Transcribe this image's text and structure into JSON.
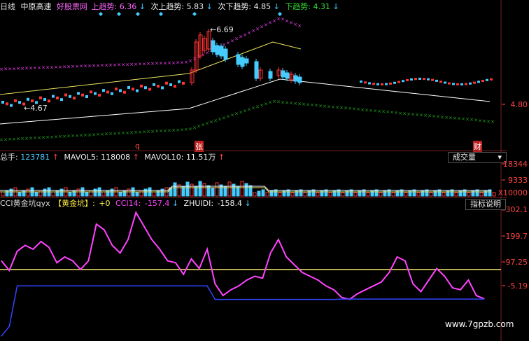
{
  "price_panel": {
    "period": "日线",
    "stock_name": "中原高速",
    "indicator_name": "好股票网",
    "up_trend_label": "上趋势:",
    "up_trend_value": "6.36",
    "next_up_label": "次上趋势:",
    "next_up_value": "5.83",
    "next_down_label": "次下趋势:",
    "next_down_value": "4.85",
    "down_trend_label": "下趋势:",
    "down_trend_value": "4.31",
    "high_marker": "6.69",
    "low_marker": "4.67",
    "axis_label": "4.80",
    "marker_q": "q",
    "marker_zhang": "张",
    "marker_cai": "财"
  },
  "volume_panel": {
    "total_label": "总手:",
    "total_value": "123781",
    "mavol5_label": "MAVOL5:",
    "mavol5_value": "118008",
    "mavol10_label": "MAVOL10:",
    "mavol10_value": "11.51万",
    "dropdown_label": "成交量",
    "axis_top": "18344",
    "axis_mid": "9333",
    "axis_unit": "X10000"
  },
  "cci_panel": {
    "title": "CCI黄金坑qyx",
    "bracket_label": "【黄金坑】:",
    "bracket_value": "+0",
    "cci14_label": "CCI14:",
    "cci14_value": "-157.4",
    "zhuidi_label": "ZHUIDI:",
    "zhuidi_value": "-158.4",
    "help_button": "指标说明",
    "axis_labels": [
      "302.1",
      "199.7",
      "97.25",
      "-5.19"
    ]
  },
  "watermark": "www.7gpzb.com",
  "colors": {
    "magenta": "#ff44ff",
    "yellow": "#e8e060",
    "white": "#ffffff",
    "green": "#22aa22",
    "cyan": "#44ccff",
    "red": "#ff3333",
    "blue": "#3344ff",
    "axis_red": "#ff4444"
  },
  "chart_data": [
    {
      "type": "line",
      "series": [
        {
          "name": "CCI14",
          "values": [
            40,
            -10,
            90,
            120,
            100,
            140,
            110,
            30,
            60,
            40,
            -5,
            40,
            230,
            200,
            120,
            80,
            150,
            290,
            220,
            150,
            100,
            40,
            30,
            -30,
            50,
            0,
            100,
            -80,
            -140,
            -110,
            -90,
            -60,
            -40,
            -50,
            80,
            150,
            60,
            20,
            -20,
            -40,
            -60,
            -90,
            -110,
            -150,
            -160,
            -130,
            -110,
            -90,
            -70,
            -20,
            60,
            40,
            -80,
            -120,
            -60,
            0,
            -40,
            -100,
            -110,
            -60,
            -140,
            -157
          ]
        },
        {
          "name": "ZHUIDI",
          "values": [
            -350,
            -300,
            -90,
            -90,
            -90,
            -90,
            -90,
            -90,
            -90,
            -90,
            -90,
            -90,
            -90,
            -90,
            -90,
            -90,
            -90,
            -90,
            -90,
            -90,
            -90,
            -90,
            -90,
            -90,
            -90,
            -90,
            -90,
            -160,
            -160,
            -160,
            -160,
            -160,
            -160,
            -160,
            -160,
            -160,
            -160,
            -160,
            -160,
            -160,
            -160,
            -160,
            -160,
            -158,
            -158,
            -158,
            -158,
            -158,
            -158,
            -158,
            -158,
            -158,
            -158,
            -158,
            -158,
            -158,
            -158,
            -158,
            -158,
            -158,
            -158,
            -158
          ]
        }
      ]
    }
  ]
}
